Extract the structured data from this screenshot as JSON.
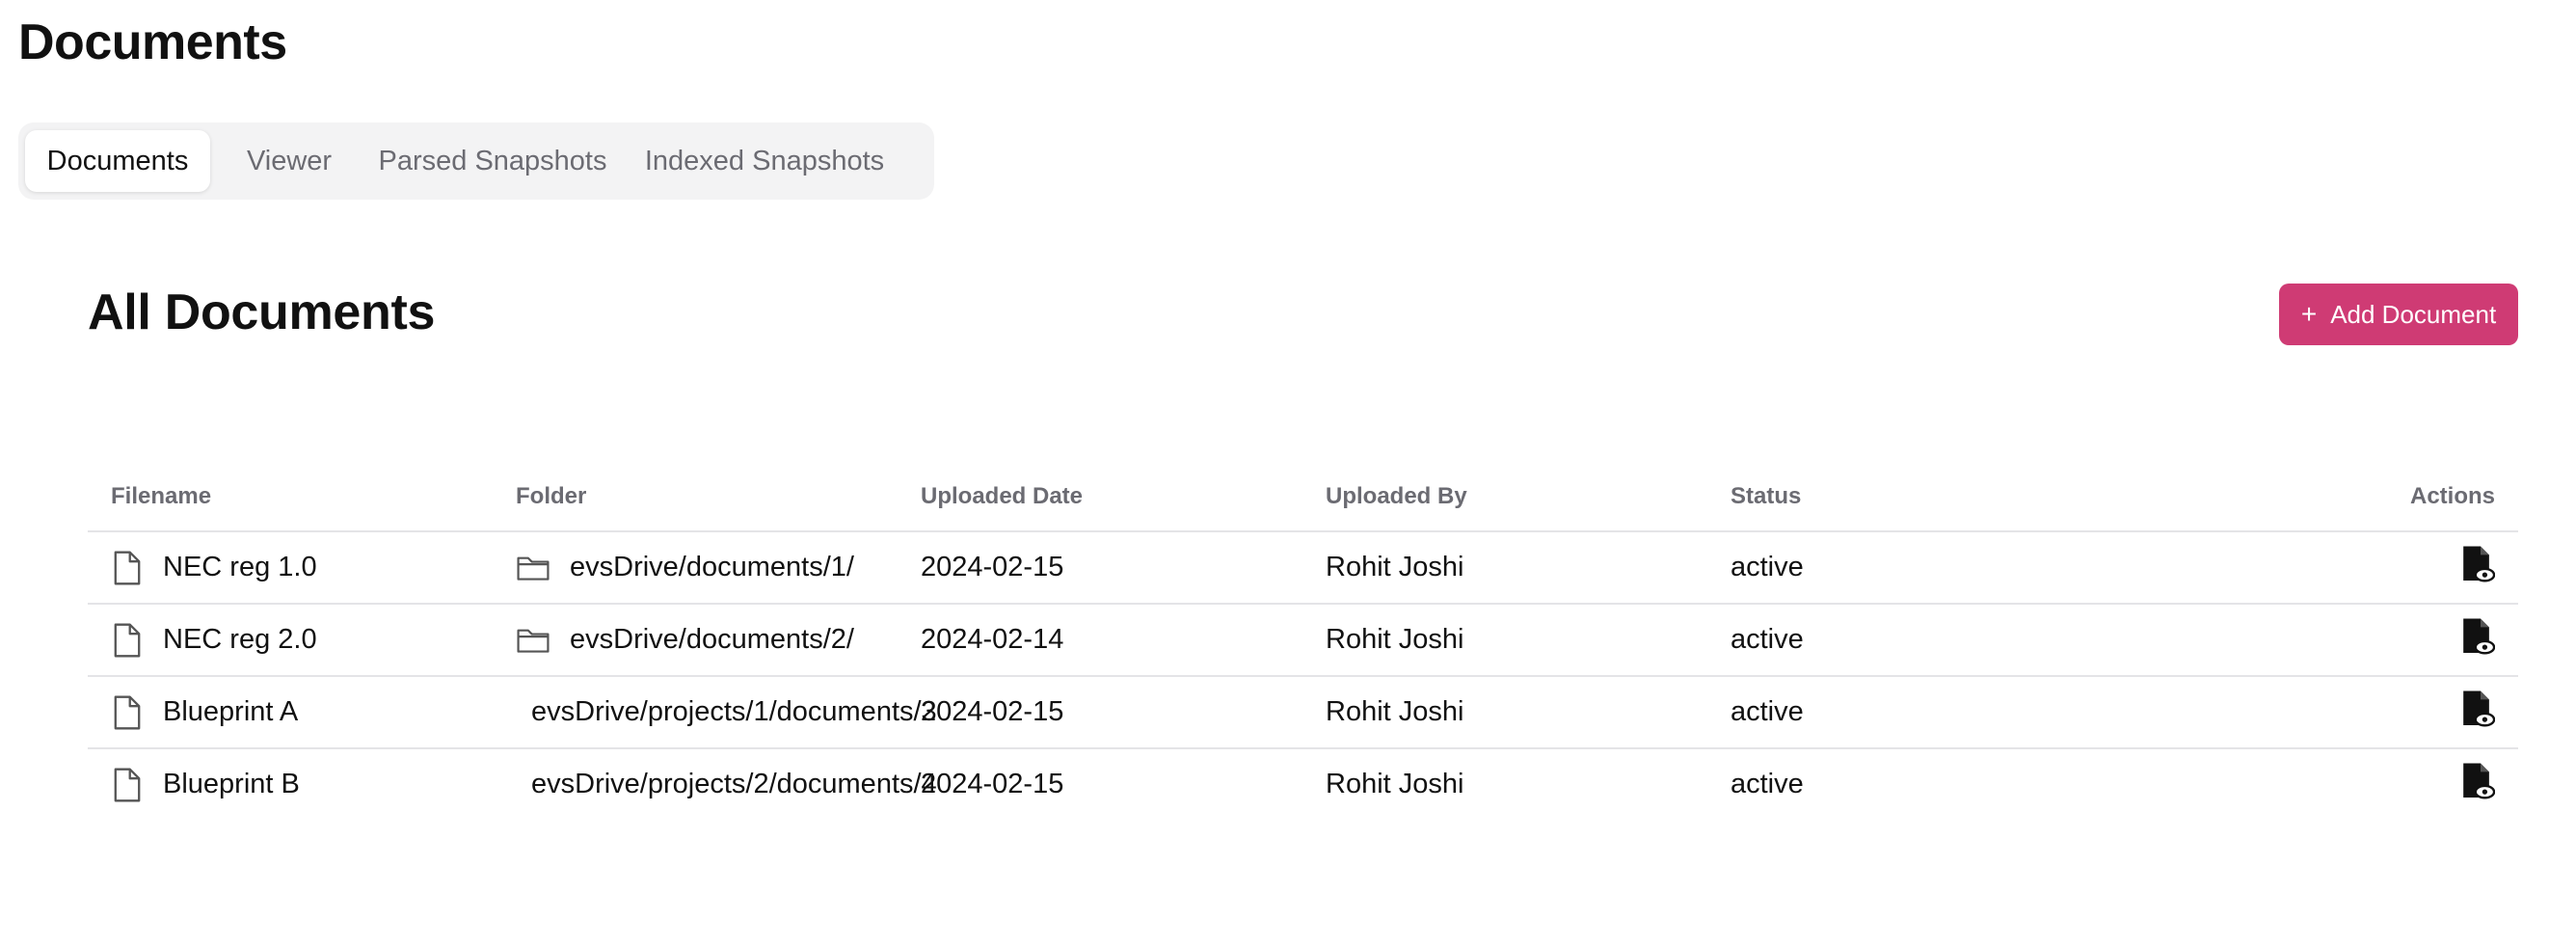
{
  "page": {
    "title": "Documents"
  },
  "tabs": [
    {
      "label": "Documents",
      "active": true
    },
    {
      "label": "Viewer",
      "active": false
    },
    {
      "label": "Parsed Snapshots",
      "active": false
    },
    {
      "label": "Indexed Snapshots",
      "active": false
    }
  ],
  "section": {
    "title": "All Documents",
    "add_button": {
      "icon": "plus-icon",
      "label": "Add Document",
      "color": "#cf3b74"
    }
  },
  "table": {
    "headers": [
      "Filename",
      "Folder",
      "Uploaded Date",
      "Uploaded By",
      "Status",
      "Actions"
    ],
    "rows": [
      {
        "filename": "NEC reg 1.0",
        "folder": "evsDrive/documents/1/",
        "folder_icon": true,
        "date": "2024-02-15",
        "by": "Rohit Joshi",
        "status": "active",
        "action_icon": "view-file-icon"
      },
      {
        "filename": "NEC reg 2.0",
        "folder": "evsDrive/documents/2/",
        "folder_icon": true,
        "date": "2024-02-14",
        "by": "Rohit Joshi",
        "status": "active",
        "action_icon": "view-file-icon"
      },
      {
        "filename": "Blueprint A",
        "folder": "evsDrive/projects/1/documents/3",
        "folder_icon": false,
        "date": "2024-02-15",
        "by": "Rohit Joshi",
        "status": "active",
        "action_icon": "view-file-icon"
      },
      {
        "filename": "Blueprint B",
        "folder": "evsDrive/projects/2/documents/4",
        "folder_icon": false,
        "date": "2024-02-15",
        "by": "Rohit Joshi",
        "status": "active",
        "action_icon": "view-file-icon"
      }
    ]
  }
}
